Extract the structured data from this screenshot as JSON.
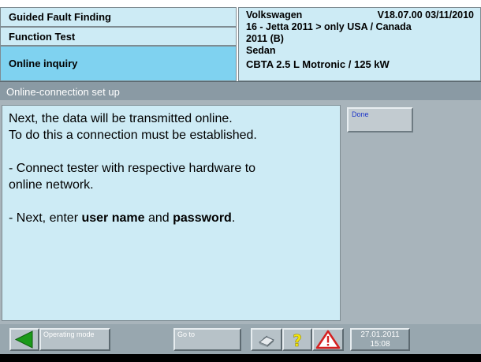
{
  "header": {
    "rows": [
      "Guided Fault Finding",
      "Function Test",
      "Online inquiry"
    ],
    "vehicle": {
      "brand": "Volkswagen",
      "version": "V18.07.00 03/11/2010",
      "model_line1": "16 - Jetta 2011 > only USA / Canada",
      "model_line2": "2011 (B)",
      "body": "Sedan",
      "engine": "CBTA 2.5 L Motronic / 125 kW"
    }
  },
  "section": {
    "title": "Online-connection set up"
  },
  "message": {
    "line1": "Next, the data will be transmitted online.",
    "line2": "To do this a connection must be established.",
    "line3": "- Connect tester with respective hardware to",
    "line4": "online network.",
    "line5_prefix": "- Next, enter ",
    "line5_bold1": "user name",
    "line5_mid": " and ",
    "line5_bold2": "password",
    "line5_suffix": "."
  },
  "buttons": {
    "done": "Done"
  },
  "toolbar": {
    "operating_mode": "Operating mode",
    "goto": "Go to",
    "date": "27.01.2011",
    "time": "15:08"
  },
  "icons": {
    "back": "back-arrow-icon",
    "print": "printer-icon",
    "help": "question-mark-icon",
    "warning": "warning-triangle-icon"
  },
  "colors": {
    "panel_light": "#cdebf5",
    "panel_active": "#7fd2f0",
    "section_bar": "#8a9aa4",
    "toolbar": "#98a7af",
    "back_arrow": "#1a9a1a",
    "help": "#f5e60a",
    "warning": "#d42020"
  }
}
